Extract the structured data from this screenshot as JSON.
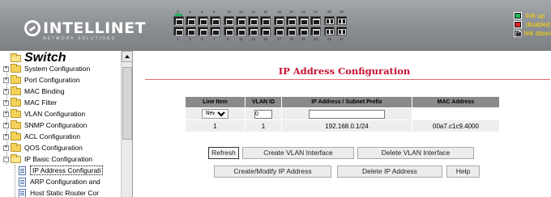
{
  "header": {
    "brand": "INTELLINET",
    "tagline": "NETWORK SOLUTIONS",
    "port_numbers_top": [
      "2",
      "4",
      "6",
      "8",
      "10",
      "12",
      "14",
      "16",
      "18",
      "20",
      "22",
      "24",
      "26",
      "28"
    ],
    "port_numbers_bottom": [
      "1",
      "3",
      "5",
      "7",
      "9",
      "11",
      "13",
      "15",
      "17",
      "19",
      "21",
      "23",
      "25",
      "27"
    ],
    "legend": [
      {
        "label": "link up",
        "state": "up"
      },
      {
        "label": "disabled",
        "state": "disabled"
      },
      {
        "label": "link down",
        "state": "down"
      }
    ]
  },
  "sidebar": {
    "title": "Switch",
    "items": [
      {
        "label": "System Configuration",
        "type": "folder"
      },
      {
        "label": "Port Configuration",
        "type": "folder"
      },
      {
        "label": "MAC Binding",
        "type": "folder"
      },
      {
        "label": "MAC Filter",
        "type": "folder"
      },
      {
        "label": "VLAN Configuration",
        "type": "folder"
      },
      {
        "label": "SNMP Configuration",
        "type": "folder"
      },
      {
        "label": "ACL Configuration",
        "type": "folder"
      },
      {
        "label": "QOS Configuration",
        "type": "folder"
      },
      {
        "label": "IP Basic Configuration",
        "type": "folder-open"
      }
    ],
    "subitems": [
      {
        "label": "IP Address Configurati",
        "selected": true
      },
      {
        "label": "ARP Configuration and",
        "selected": false
      },
      {
        "label": "Host Static Router Cor",
        "selected": false
      }
    ]
  },
  "main": {
    "title": "IP Address Configuration",
    "table": {
      "headers": [
        "Line Item",
        "VLAN ID",
        "IP Address / Subnet Prefix",
        "MAC Address"
      ],
      "input_row": {
        "select_value": "New",
        "vlan_value": "0",
        "ip_value": ""
      },
      "rows": [
        {
          "line": "1",
          "vlan": "1",
          "ip": "192.168.0.1/24",
          "mac": "00a7.c1c9.4000"
        }
      ]
    },
    "buttons": {
      "refresh": "Refresh",
      "create_vlan": "Create VLAN Interface",
      "delete_vlan": "Delete VLAN Interface",
      "create_modify_ip": "Create/Modify IP Address",
      "delete_ip": "Delete IP Address",
      "help": "Help"
    }
  },
  "colors": {
    "title_red": "#c8102e",
    "link_up_green": "#21b35a",
    "legend_text": "#ffd700",
    "header_grey": "#8e9195"
  }
}
